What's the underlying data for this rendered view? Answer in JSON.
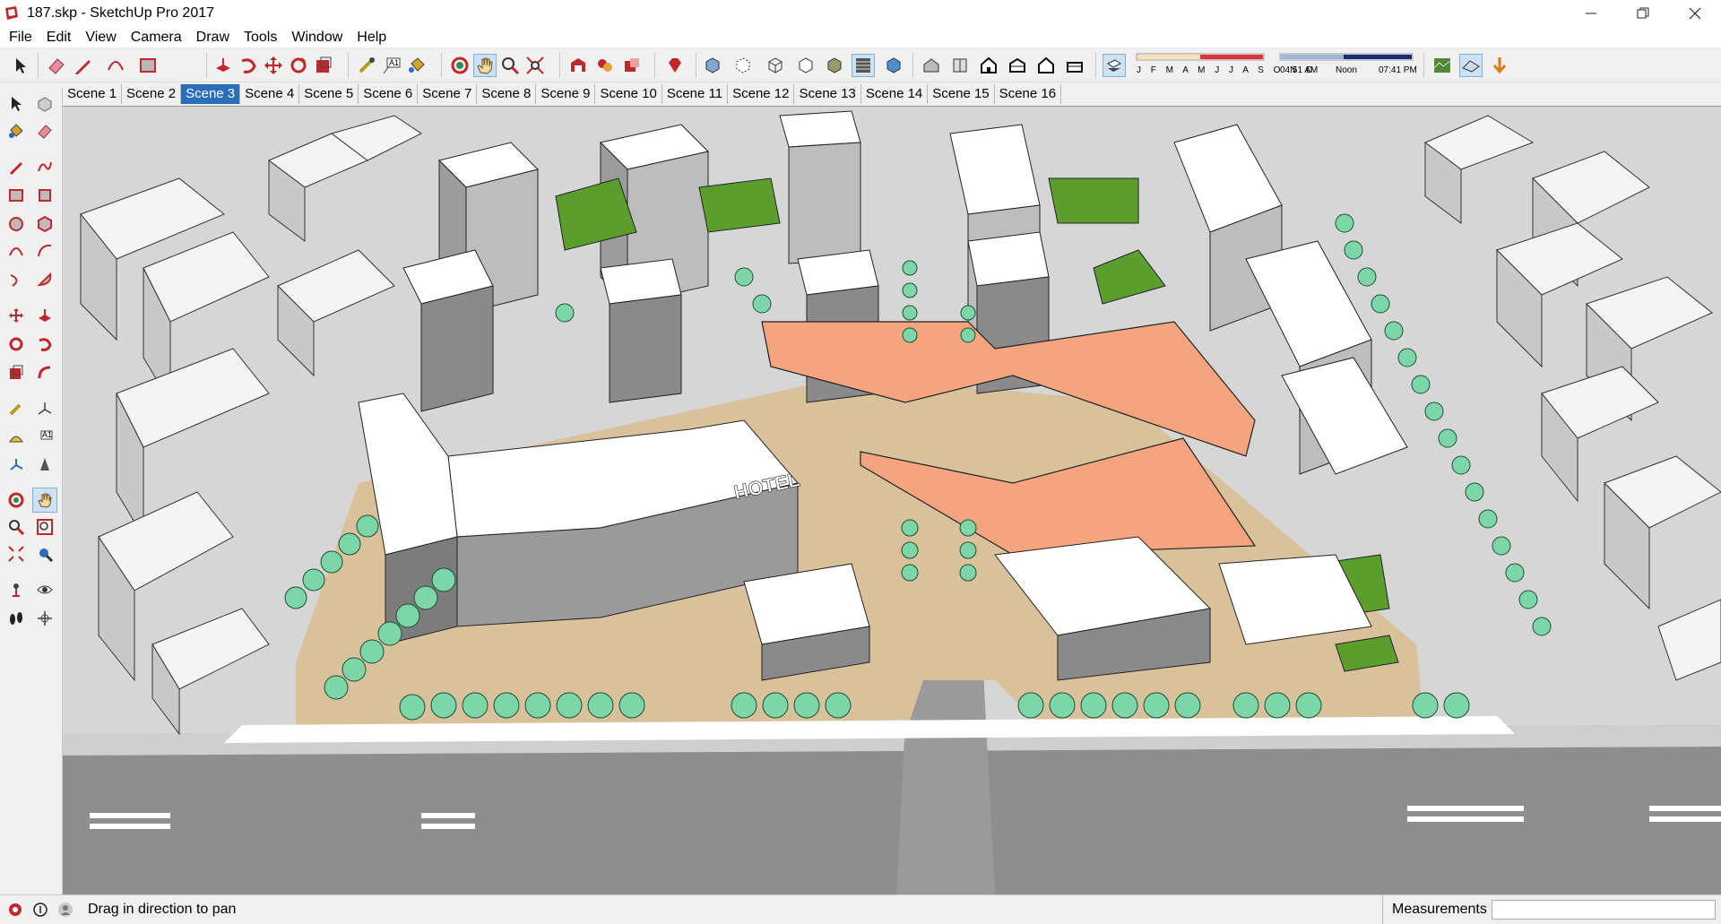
{
  "window": {
    "title": "187.skp - SketchUp Pro 2017",
    "controls": [
      "minimize",
      "restore",
      "close"
    ]
  },
  "menu": [
    "File",
    "Edit",
    "View",
    "Camera",
    "Draw",
    "Tools",
    "Window",
    "Help"
  ],
  "toolbar": {
    "tools": [
      "select-tool",
      "eraser-tool",
      "line-tool",
      "arc-tool",
      "rectangle-tool",
      "push-pull-tool",
      "follow-me-tool",
      "move-tool",
      "rotate-tool",
      "scale-tool",
      "tape-measure-tool",
      "text-tool",
      "paint-bucket-tool",
      "orbit-tool",
      "pan-tool",
      "zoom-tool",
      "zoom-extents-tool",
      "3d-warehouse-tool",
      "extension-warehouse-tool",
      "share-model-tool",
      "ruby-tool",
      "xray-tool",
      "back-edges-tool",
      "wireframe-tool",
      "hidden-line-tool",
      "shaded-tool",
      "shaded-textures-tool",
      "monochrome-tool",
      "iso-view-tool",
      "top-view-tool",
      "front-view-tool",
      "right-view-tool",
      "back-view-tool",
      "left-view-tool",
      "shadows-toggle-tool",
      "sandbox-tool",
      "match-photo-tool",
      "fog-tool",
      "section-tool"
    ],
    "shadow_months": "J F M A M J J A S O N D",
    "shadow_time_start": "04:51 AM",
    "shadow_time_mid": "Noon",
    "shadow_time_end": "07:41 PM"
  },
  "scenes": {
    "tabs": [
      "Scene 1",
      "Scene 2",
      "Scene 3",
      "Scene 4",
      "Scene 5",
      "Scene 6",
      "Scene 7",
      "Scene 8",
      "Scene 9",
      "Scene 10",
      "Scene 11",
      "Scene 12",
      "Scene 13",
      "Scene 14",
      "Scene 15",
      "Scene 16"
    ],
    "active": "Scene 3"
  },
  "model": {
    "sign_text": "HOTEL"
  },
  "status": {
    "message": "Drag in direction to pan",
    "measurements_label": "Measurements",
    "measurements_value": ""
  },
  "colors": {
    "accent_blue": "#2a6ebb",
    "roof_orange": "#f4a57f",
    "green_roof": "#5c9e2e",
    "tree_green": "#7dd6a8",
    "ground_tan": "#d9c19b"
  }
}
